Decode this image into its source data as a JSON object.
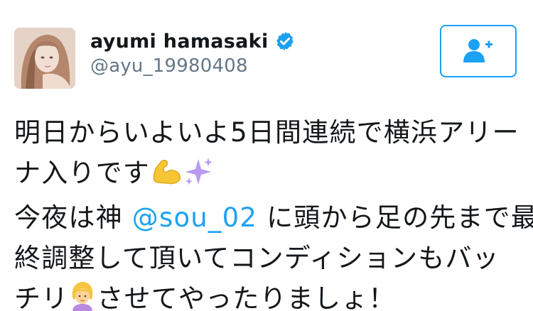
{
  "user": {
    "display_name": "ayumi hamasaki",
    "handle": "@ayu_19980408",
    "verified": true,
    "avatar_icon": "profile-photo"
  },
  "follow_button": {
    "icon": "follow-person-plus-icon",
    "color": "#1da1f2"
  },
  "tweet": {
    "line1": "明日からいよいよ5日間連続で横浜アリー",
    "line2_text": "ナ入りです",
    "line2_emoji": [
      "flexed-biceps-emoji",
      "sparkles-emoji"
    ],
    "line3_prefix": "今夜は神 ",
    "line3_mention": "@sou_02",
    "line3_suffix": " に頭から足の先まで最",
    "line4": "終調整して頂いてコンディションもバッ",
    "line5_prefix": "チリ",
    "line5_emoji": "person-getting-haircut-emoji",
    "line5_suffix": "させてやったりましょ！",
    "mention_color": "#1da1f2"
  },
  "colors": {
    "verified_badge": "#1da1f2",
    "handle": "#657786",
    "text": "#14171a"
  }
}
